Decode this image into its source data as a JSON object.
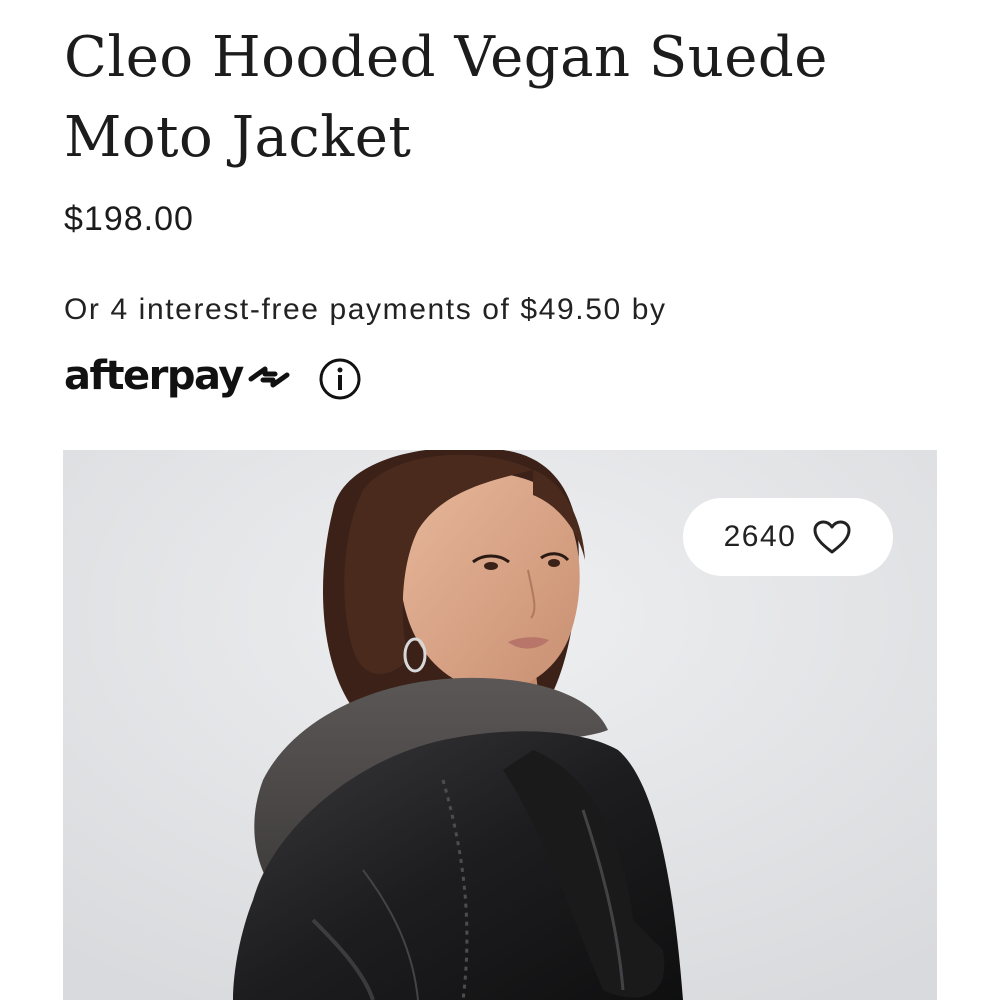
{
  "product": {
    "title": "Cleo Hooded Vegan Suede Moto Jacket",
    "price": "$198.00"
  },
  "payment": {
    "installments_text": "Or 4 interest-free payments of $49.50 by",
    "provider_logo_text": "afterpay",
    "info_icon": "info-circle-icon"
  },
  "hero_image": {
    "alt": "Model wearing a black hooded vegan suede moto jacket, looking over her shoulder",
    "favorites": {
      "count": "2640",
      "icon": "heart-outline-icon"
    }
  },
  "colors": {
    "text": "#1c1c1c",
    "image_background": "#e4e5e8",
    "pill_background": "#ffffff"
  }
}
